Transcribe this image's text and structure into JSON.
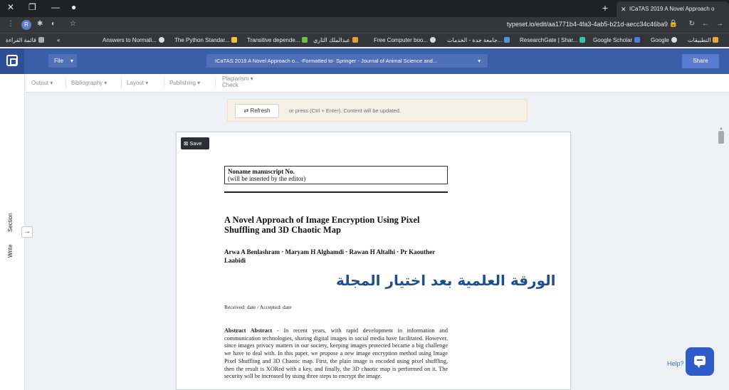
{
  "browser": {
    "tab_title": "ICaTAS 2019 A Novel Approach o",
    "url": "typeset.io/edit/aa1771b4-4fa3-4ab5-b21d-aecc34c46ba9",
    "profile_initial": "R",
    "bookmarks": [
      "قائمة القراءة",
      "Answers to Normali...",
      "The Python Standar...",
      "Transitive depende...",
      "عبدالملك الثاري",
      "Free Computer boo...",
      "جامعة جدة - الخدمات...",
      "ResearchGate | Shar...",
      "Google Scholar",
      "Google",
      "التطبيقات"
    ]
  },
  "app": {
    "file_label": "File",
    "doc_title_bar": "ICaTAS 2019 A Novel Approach o...   -Formatted to-   Springer - Journal of Animal Science and...",
    "share_label": "Share",
    "toolbar": {
      "output": "Output",
      "bibliography": "Bibliography",
      "layout": "Layout",
      "publishing": "Publishing",
      "plagiarism_line1": "Plagiarism",
      "plagiarism_line2": "Check"
    },
    "left_rail": {
      "write": "Write",
      "section": "Section"
    },
    "banner": {
      "refresh_label": "Refresh",
      "hint": "or press (Ctrl + Enter). Content will be updated."
    },
    "help_label": "Help?"
  },
  "document": {
    "save_label": "Save",
    "manuscript_line1": "Noname manuscript No.",
    "manuscript_line2": "(will be inserted by the editor)",
    "title": "A Novel Approach of Image Encryption Using Pixel Shuffling and 3D Chaotic Map",
    "authors": "Arwa A Benlashram · Maryam H Alghamdi · Rawan H Altalhi · Pr Kaouther Laabidi",
    "overlay_arabic": "الورقة العلمية بعد اختيار المجلة",
    "received": "Received: date / Accepted: date",
    "abstract_label": "Abstract  Abstract",
    "abstract_text": " - In recent years, with rapid development in information and communication technologies, sharing digital images in social media have facilitated. However, since images privacy matters in our society, keeping images protected became a big challenge we have to deal with. In this paper, we propose a new image encryption method using Image Pixel Shuffling and 3D Chaotic map. First, the plain image is encoded using pixel shuffling, then the result is XORed with a key, and finally, the 3D chaotic map is performed on it. The security will be increased by using three steps to encrypt the image."
  },
  "colors": {
    "app_header": "#3b5ea8",
    "share_button": "#5b7bd0",
    "help_button": "#2f5cc9",
    "overlay_text": "#1f4f8a"
  }
}
